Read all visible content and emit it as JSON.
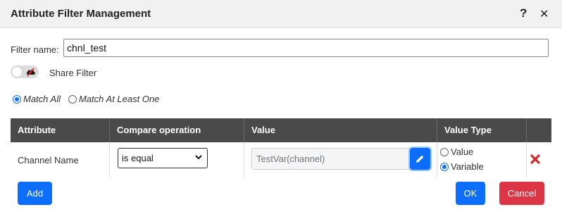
{
  "dialog": {
    "title": "Attribute Filter Management",
    "help_glyph": "?",
    "close_glyph": "✕"
  },
  "filter": {
    "name_label": "Filter name:",
    "name_value": "chnl_test",
    "share_toggle_on": false,
    "share_label": "Share Filter"
  },
  "match": {
    "options": [
      {
        "label": "Match All",
        "checked": true
      },
      {
        "label": "Match At Least One",
        "checked": false
      }
    ]
  },
  "table": {
    "headers": [
      "Attribute",
      "Compare operation",
      "Value",
      "Value Type"
    ],
    "rows": [
      {
        "attribute": "Channel Name",
        "compare_operation": "is equal",
        "value": "TestVar(channel)",
        "value_type_options": [
          {
            "label": "Value",
            "checked": false
          },
          {
            "label": "Variable",
            "checked": true
          }
        ]
      }
    ]
  },
  "buttons": {
    "add": "Add",
    "ok": "OK",
    "cancel": "Cancel"
  },
  "colors": {
    "primary": "#0d6efd",
    "danger": "#dc3545",
    "header_bg": "#4a4a4a",
    "titlebar_bg": "#f1f1f1"
  },
  "icons": {
    "help": "question-icon",
    "close": "close-icon",
    "share_toggle": "cloud-blocked-icon",
    "select_chevron": "chevron-down-icon",
    "edit": "pencil-icon",
    "delete": "red-x-icon"
  }
}
